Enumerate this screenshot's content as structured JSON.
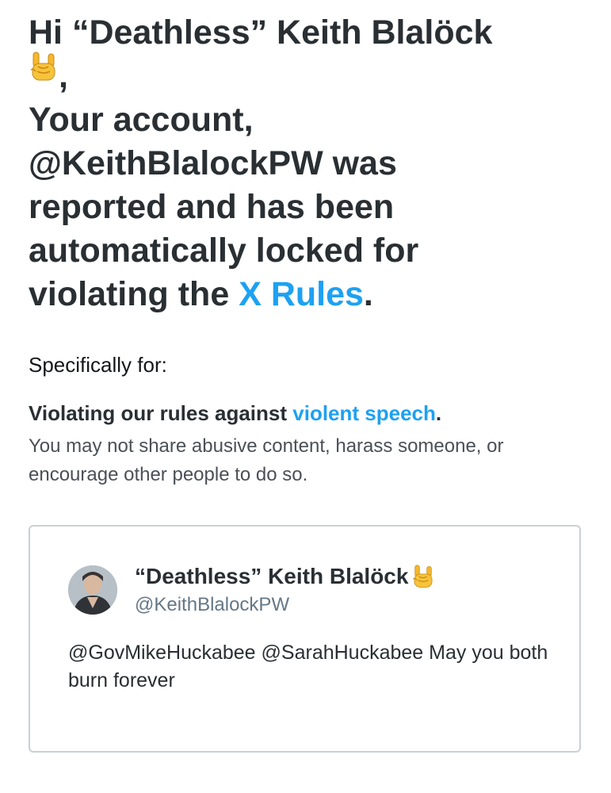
{
  "greeting": {
    "prefix": "Hi ",
    "name": "“Deathless” Keith Blalöck",
    "emoji_icon": "sign-of-the-horns-icon",
    "after_emoji": ",",
    "line_account": "Your account,",
    "line_handle_was": "@KeithBlalockPW was",
    "line_reported": "reported and has been",
    "line_locked": "automatically locked for",
    "violating_prefix": "violating the ",
    "rules_link": "X Rules",
    "period": "."
  },
  "specifically_label": "Specifically for:",
  "violation": {
    "title_prefix": "Violating our rules against ",
    "title_link": "violent speech",
    "title_suffix": ".",
    "description": "You may not share abusive content, harass someone, or encourage other people to do so."
  },
  "tweet": {
    "author_name": "“Deathless” Keith Blalöck",
    "author_emoji_icon": "sign-of-the-horns-icon",
    "author_handle": "@KeithBlalockPW",
    "text": "@GovMikeHuckabee @SarahHuckabee May you both burn forever"
  },
  "colors": {
    "link": "#1da1f2",
    "heading": "#292f33",
    "secondary": "#657786",
    "card_border": "#c9d0d6"
  }
}
